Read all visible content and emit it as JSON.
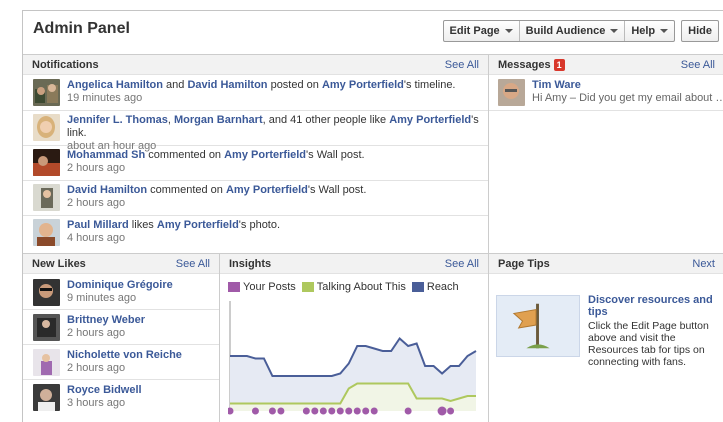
{
  "header": {
    "title": "Admin Panel",
    "edit_page": "Edit Page",
    "build_audience": "Build Audience",
    "help": "Help",
    "hide": "Hide"
  },
  "notifications": {
    "title": "Notifications",
    "see_all": "See All",
    "items": [
      {
        "pre": "",
        "a1": "Angelica Hamilton",
        "mid1": " and ",
        "a2": "David Hamilton",
        "mid2": " posted on ",
        "a3": "Amy Porterfield",
        "post": "'s timeline.",
        "time": "19 minutes ago"
      },
      {
        "pre": "",
        "a1": "Jennifer L. Thomas",
        "mid1": ", ",
        "a2": "Morgan Barnhart",
        "mid2": ", and 41 other people like ",
        "a3": "Amy Porterfield",
        "post": "'s link.",
        "time": "about an hour ago"
      },
      {
        "pre": "",
        "a1": "Mohammad Sh",
        "mid1": " commented on ",
        "a2": "Amy Porterfield",
        "mid2": "",
        "a3": "",
        "post": "'s Wall post.",
        "time": "2 hours ago"
      },
      {
        "pre": "",
        "a1": "David Hamilton",
        "mid1": " commented on ",
        "a2": "Amy Porterfield",
        "mid2": "",
        "a3": "",
        "post": "'s Wall post.",
        "time": "2 hours ago"
      },
      {
        "pre": "",
        "a1": "Paul Millard",
        "mid1": " likes ",
        "a2": "Amy Porterfield",
        "mid2": "",
        "a3": "",
        "post": "'s photo.",
        "time": "4 hours ago"
      }
    ]
  },
  "messages": {
    "title": "Messages",
    "count": "1",
    "see_all": "See All",
    "items": [
      {
        "name": "Tim Ware",
        "snippet": "Hi Amy – Did you get my email about …"
      }
    ]
  },
  "new_likes": {
    "title": "New Likes",
    "see_all": "See All",
    "items": [
      {
        "name": "Dominique Grégoire",
        "time": "9 minutes ago"
      },
      {
        "name": "Brittney Weber",
        "time": "2 hours ago"
      },
      {
        "name": "Nicholette von Reiche",
        "time": "2 hours ago"
      },
      {
        "name": "Royce Bidwell",
        "time": "3 hours ago"
      }
    ]
  },
  "insights": {
    "title": "Insights",
    "see_all": "See All"
  },
  "page_tips": {
    "title": "Page Tips",
    "next": "Next",
    "tip_title": "Discover resources and tips",
    "tip_body": "Click the Edit Page button above and visit the Resources tab for tips on connecting with fans."
  },
  "colors": {
    "link": "#3b5998",
    "your_posts": "#a05aa8",
    "talking_about": "#aec85e",
    "reach": "#4a5e98",
    "badge": "#d8372b"
  },
  "chart_data": {
    "type": "area",
    "series": [
      {
        "name": "Your Posts",
        "points": [
          0,
          0,
          0,
          0,
          0,
          0,
          0,
          0,
          0,
          0,
          0,
          0,
          0,
          0,
          0,
          0,
          0,
          0,
          0,
          0,
          0,
          0,
          0,
          0,
          0,
          0,
          0,
          0,
          0,
          0
        ],
        "markers": [
          1,
          0,
          0,
          1,
          0,
          1,
          1,
          0,
          0,
          1,
          1,
          1,
          1,
          1,
          1,
          1,
          1,
          1,
          0,
          0,
          0,
          1,
          0,
          0,
          0,
          1,
          1,
          0,
          0,
          0
        ]
      },
      {
        "name": "Talking About This",
        "points": [
          3,
          3,
          3,
          3,
          3,
          3,
          3,
          3,
          3,
          3,
          3,
          3,
          3,
          3,
          9,
          11,
          11,
          11,
          11,
          11,
          11,
          11,
          5,
          5,
          5,
          5,
          4,
          5,
          6,
          6
        ]
      },
      {
        "name": "Reach",
        "points": [
          22,
          22,
          22,
          21,
          21,
          14,
          14,
          14,
          14,
          14,
          14,
          14,
          14,
          15,
          19,
          26,
          26,
          25,
          24,
          24,
          29,
          26,
          27,
          18,
          18,
          15,
          18,
          18,
          22,
          24
        ]
      }
    ],
    "legend": "top"
  }
}
